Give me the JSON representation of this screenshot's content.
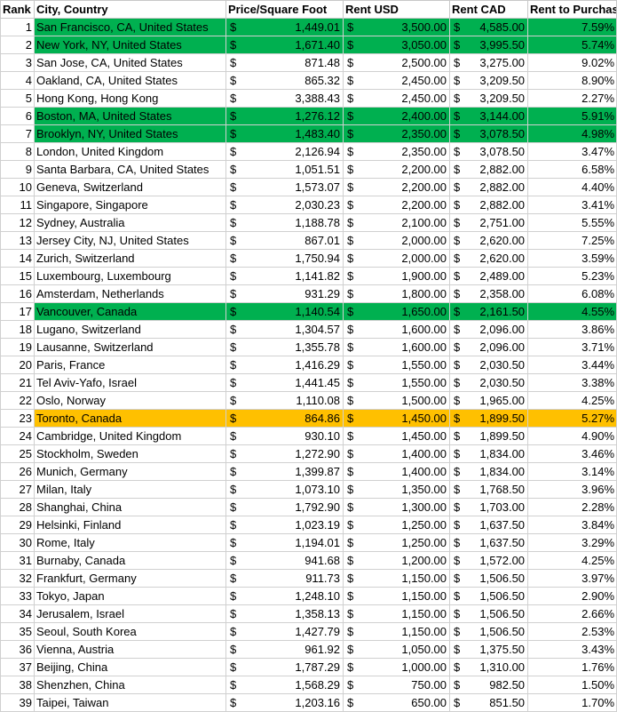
{
  "headers": {
    "rank": "Rank",
    "city": "City, Country",
    "price_sqft": "Price/Square Foot",
    "rent_usd": "Rent USD",
    "rent_cad": "Rent CAD",
    "rent_to_purchase": "Rent to Purchase"
  },
  "currency_symbol": "$",
  "highlight_colors": {
    "green": "#00b050",
    "orange": "#ffc000"
  },
  "rows": [
    {
      "rank": "1",
      "city": "San Francisco, CA, United States",
      "price_sqft": "1,449.01",
      "rent_usd": "3,500.00",
      "rent_cad": "4,585.00",
      "rent_to_purchase": "7.59%",
      "highlight": "green"
    },
    {
      "rank": "2",
      "city": "New York, NY, United States",
      "price_sqft": "1,671.40",
      "rent_usd": "3,050.00",
      "rent_cad": "3,995.50",
      "rent_to_purchase": "5.74%",
      "highlight": "green"
    },
    {
      "rank": "3",
      "city": "San Jose, CA, United States",
      "price_sqft": "871.48",
      "rent_usd": "2,500.00",
      "rent_cad": "3,275.00",
      "rent_to_purchase": "9.02%",
      "highlight": ""
    },
    {
      "rank": "4",
      "city": "Oakland, CA, United States",
      "price_sqft": "865.32",
      "rent_usd": "2,450.00",
      "rent_cad": "3,209.50",
      "rent_to_purchase": "8.90%",
      "highlight": ""
    },
    {
      "rank": "5",
      "city": "Hong Kong, Hong Kong",
      "price_sqft": "3,388.43",
      "rent_usd": "2,450.00",
      "rent_cad": "3,209.50",
      "rent_to_purchase": "2.27%",
      "highlight": ""
    },
    {
      "rank": "6",
      "city": "Boston, MA, United States",
      "price_sqft": "1,276.12",
      "rent_usd": "2,400.00",
      "rent_cad": "3,144.00",
      "rent_to_purchase": "5.91%",
      "highlight": "green"
    },
    {
      "rank": "7",
      "city": "Brooklyn, NY, United States",
      "price_sqft": "1,483.40",
      "rent_usd": "2,350.00",
      "rent_cad": "3,078.50",
      "rent_to_purchase": "4.98%",
      "highlight": "green"
    },
    {
      "rank": "8",
      "city": "London, United Kingdom",
      "price_sqft": "2,126.94",
      "rent_usd": "2,350.00",
      "rent_cad": "3,078.50",
      "rent_to_purchase": "3.47%",
      "highlight": ""
    },
    {
      "rank": "9",
      "city": "Santa Barbara, CA, United States",
      "price_sqft": "1,051.51",
      "rent_usd": "2,200.00",
      "rent_cad": "2,882.00",
      "rent_to_purchase": "6.58%",
      "highlight": ""
    },
    {
      "rank": "10",
      "city": "Geneva, Switzerland",
      "price_sqft": "1,573.07",
      "rent_usd": "2,200.00",
      "rent_cad": "2,882.00",
      "rent_to_purchase": "4.40%",
      "highlight": ""
    },
    {
      "rank": "11",
      "city": "Singapore, Singapore",
      "price_sqft": "2,030.23",
      "rent_usd": "2,200.00",
      "rent_cad": "2,882.00",
      "rent_to_purchase": "3.41%",
      "highlight": ""
    },
    {
      "rank": "12",
      "city": "Sydney, Australia",
      "price_sqft": "1,188.78",
      "rent_usd": "2,100.00",
      "rent_cad": "2,751.00",
      "rent_to_purchase": "5.55%",
      "highlight": ""
    },
    {
      "rank": "13",
      "city": "Jersey City, NJ, United States",
      "price_sqft": "867.01",
      "rent_usd": "2,000.00",
      "rent_cad": "2,620.00",
      "rent_to_purchase": "7.25%",
      "highlight": ""
    },
    {
      "rank": "14",
      "city": "Zurich, Switzerland",
      "price_sqft": "1,750.94",
      "rent_usd": "2,000.00",
      "rent_cad": "2,620.00",
      "rent_to_purchase": "3.59%",
      "highlight": ""
    },
    {
      "rank": "15",
      "city": "Luxembourg, Luxembourg",
      "price_sqft": "1,141.82",
      "rent_usd": "1,900.00",
      "rent_cad": "2,489.00",
      "rent_to_purchase": "5.23%",
      "highlight": ""
    },
    {
      "rank": "16",
      "city": "Amsterdam, Netherlands",
      "price_sqft": "931.29",
      "rent_usd": "1,800.00",
      "rent_cad": "2,358.00",
      "rent_to_purchase": "6.08%",
      "highlight": ""
    },
    {
      "rank": "17",
      "city": "Vancouver, Canada",
      "price_sqft": "1,140.54",
      "rent_usd": "1,650.00",
      "rent_cad": "2,161.50",
      "rent_to_purchase": "4.55%",
      "highlight": "green"
    },
    {
      "rank": "18",
      "city": "Lugano, Switzerland",
      "price_sqft": "1,304.57",
      "rent_usd": "1,600.00",
      "rent_cad": "2,096.00",
      "rent_to_purchase": "3.86%",
      "highlight": ""
    },
    {
      "rank": "19",
      "city": "Lausanne, Switzerland",
      "price_sqft": "1,355.78",
      "rent_usd": "1,600.00",
      "rent_cad": "2,096.00",
      "rent_to_purchase": "3.71%",
      "highlight": ""
    },
    {
      "rank": "20",
      "city": "Paris, France",
      "price_sqft": "1,416.29",
      "rent_usd": "1,550.00",
      "rent_cad": "2,030.50",
      "rent_to_purchase": "3.44%",
      "highlight": ""
    },
    {
      "rank": "21",
      "city": "Tel Aviv-Yafo, Israel",
      "price_sqft": "1,441.45",
      "rent_usd": "1,550.00",
      "rent_cad": "2,030.50",
      "rent_to_purchase": "3.38%",
      "highlight": ""
    },
    {
      "rank": "22",
      "city": "Oslo, Norway",
      "price_sqft": "1,110.08",
      "rent_usd": "1,500.00",
      "rent_cad": "1,965.00",
      "rent_to_purchase": "4.25%",
      "highlight": ""
    },
    {
      "rank": "23",
      "city": "Toronto, Canada",
      "price_sqft": "864.86",
      "rent_usd": "1,450.00",
      "rent_cad": "1,899.50",
      "rent_to_purchase": "5.27%",
      "highlight": "orange"
    },
    {
      "rank": "24",
      "city": "Cambridge, United Kingdom",
      "price_sqft": "930.10",
      "rent_usd": "1,450.00",
      "rent_cad": "1,899.50",
      "rent_to_purchase": "4.90%",
      "highlight": ""
    },
    {
      "rank": "25",
      "city": "Stockholm, Sweden",
      "price_sqft": "1,272.90",
      "rent_usd": "1,400.00",
      "rent_cad": "1,834.00",
      "rent_to_purchase": "3.46%",
      "highlight": ""
    },
    {
      "rank": "26",
      "city": "Munich, Germany",
      "price_sqft": "1,399.87",
      "rent_usd": "1,400.00",
      "rent_cad": "1,834.00",
      "rent_to_purchase": "3.14%",
      "highlight": ""
    },
    {
      "rank": "27",
      "city": "Milan, Italy",
      "price_sqft": "1,073.10",
      "rent_usd": "1,350.00",
      "rent_cad": "1,768.50",
      "rent_to_purchase": "3.96%",
      "highlight": ""
    },
    {
      "rank": "28",
      "city": "Shanghai, China",
      "price_sqft": "1,792.90",
      "rent_usd": "1,300.00",
      "rent_cad": "1,703.00",
      "rent_to_purchase": "2.28%",
      "highlight": ""
    },
    {
      "rank": "29",
      "city": "Helsinki, Finland",
      "price_sqft": "1,023.19",
      "rent_usd": "1,250.00",
      "rent_cad": "1,637.50",
      "rent_to_purchase": "3.84%",
      "highlight": ""
    },
    {
      "rank": "30",
      "city": "Rome, Italy",
      "price_sqft": "1,194.01",
      "rent_usd": "1,250.00",
      "rent_cad": "1,637.50",
      "rent_to_purchase": "3.29%",
      "highlight": ""
    },
    {
      "rank": "31",
      "city": "Burnaby, Canada",
      "price_sqft": "941.68",
      "rent_usd": "1,200.00",
      "rent_cad": "1,572.00",
      "rent_to_purchase": "4.25%",
      "highlight": ""
    },
    {
      "rank": "32",
      "city": "Frankfurt, Germany",
      "price_sqft": "911.73",
      "rent_usd": "1,150.00",
      "rent_cad": "1,506.50",
      "rent_to_purchase": "3.97%",
      "highlight": ""
    },
    {
      "rank": "33",
      "city": "Tokyo, Japan",
      "price_sqft": "1,248.10",
      "rent_usd": "1,150.00",
      "rent_cad": "1,506.50",
      "rent_to_purchase": "2.90%",
      "highlight": ""
    },
    {
      "rank": "34",
      "city": "Jerusalem, Israel",
      "price_sqft": "1,358.13",
      "rent_usd": "1,150.00",
      "rent_cad": "1,506.50",
      "rent_to_purchase": "2.66%",
      "highlight": ""
    },
    {
      "rank": "35",
      "city": "Seoul, South Korea",
      "price_sqft": "1,427.79",
      "rent_usd": "1,150.00",
      "rent_cad": "1,506.50",
      "rent_to_purchase": "2.53%",
      "highlight": ""
    },
    {
      "rank": "36",
      "city": "Vienna, Austria",
      "price_sqft": "961.92",
      "rent_usd": "1,050.00",
      "rent_cad": "1,375.50",
      "rent_to_purchase": "3.43%",
      "highlight": ""
    },
    {
      "rank": "37",
      "city": "Beijing, China",
      "price_sqft": "1,787.29",
      "rent_usd": "1,000.00",
      "rent_cad": "1,310.00",
      "rent_to_purchase": "1.76%",
      "highlight": ""
    },
    {
      "rank": "38",
      "city": "Shenzhen, China",
      "price_sqft": "1,568.29",
      "rent_usd": "750.00",
      "rent_cad": "982.50",
      "rent_to_purchase": "1.50%",
      "highlight": ""
    },
    {
      "rank": "39",
      "city": "Taipei, Taiwan",
      "price_sqft": "1,203.16",
      "rent_usd": "650.00",
      "rent_cad": "851.50",
      "rent_to_purchase": "1.70%",
      "highlight": ""
    }
  ]
}
